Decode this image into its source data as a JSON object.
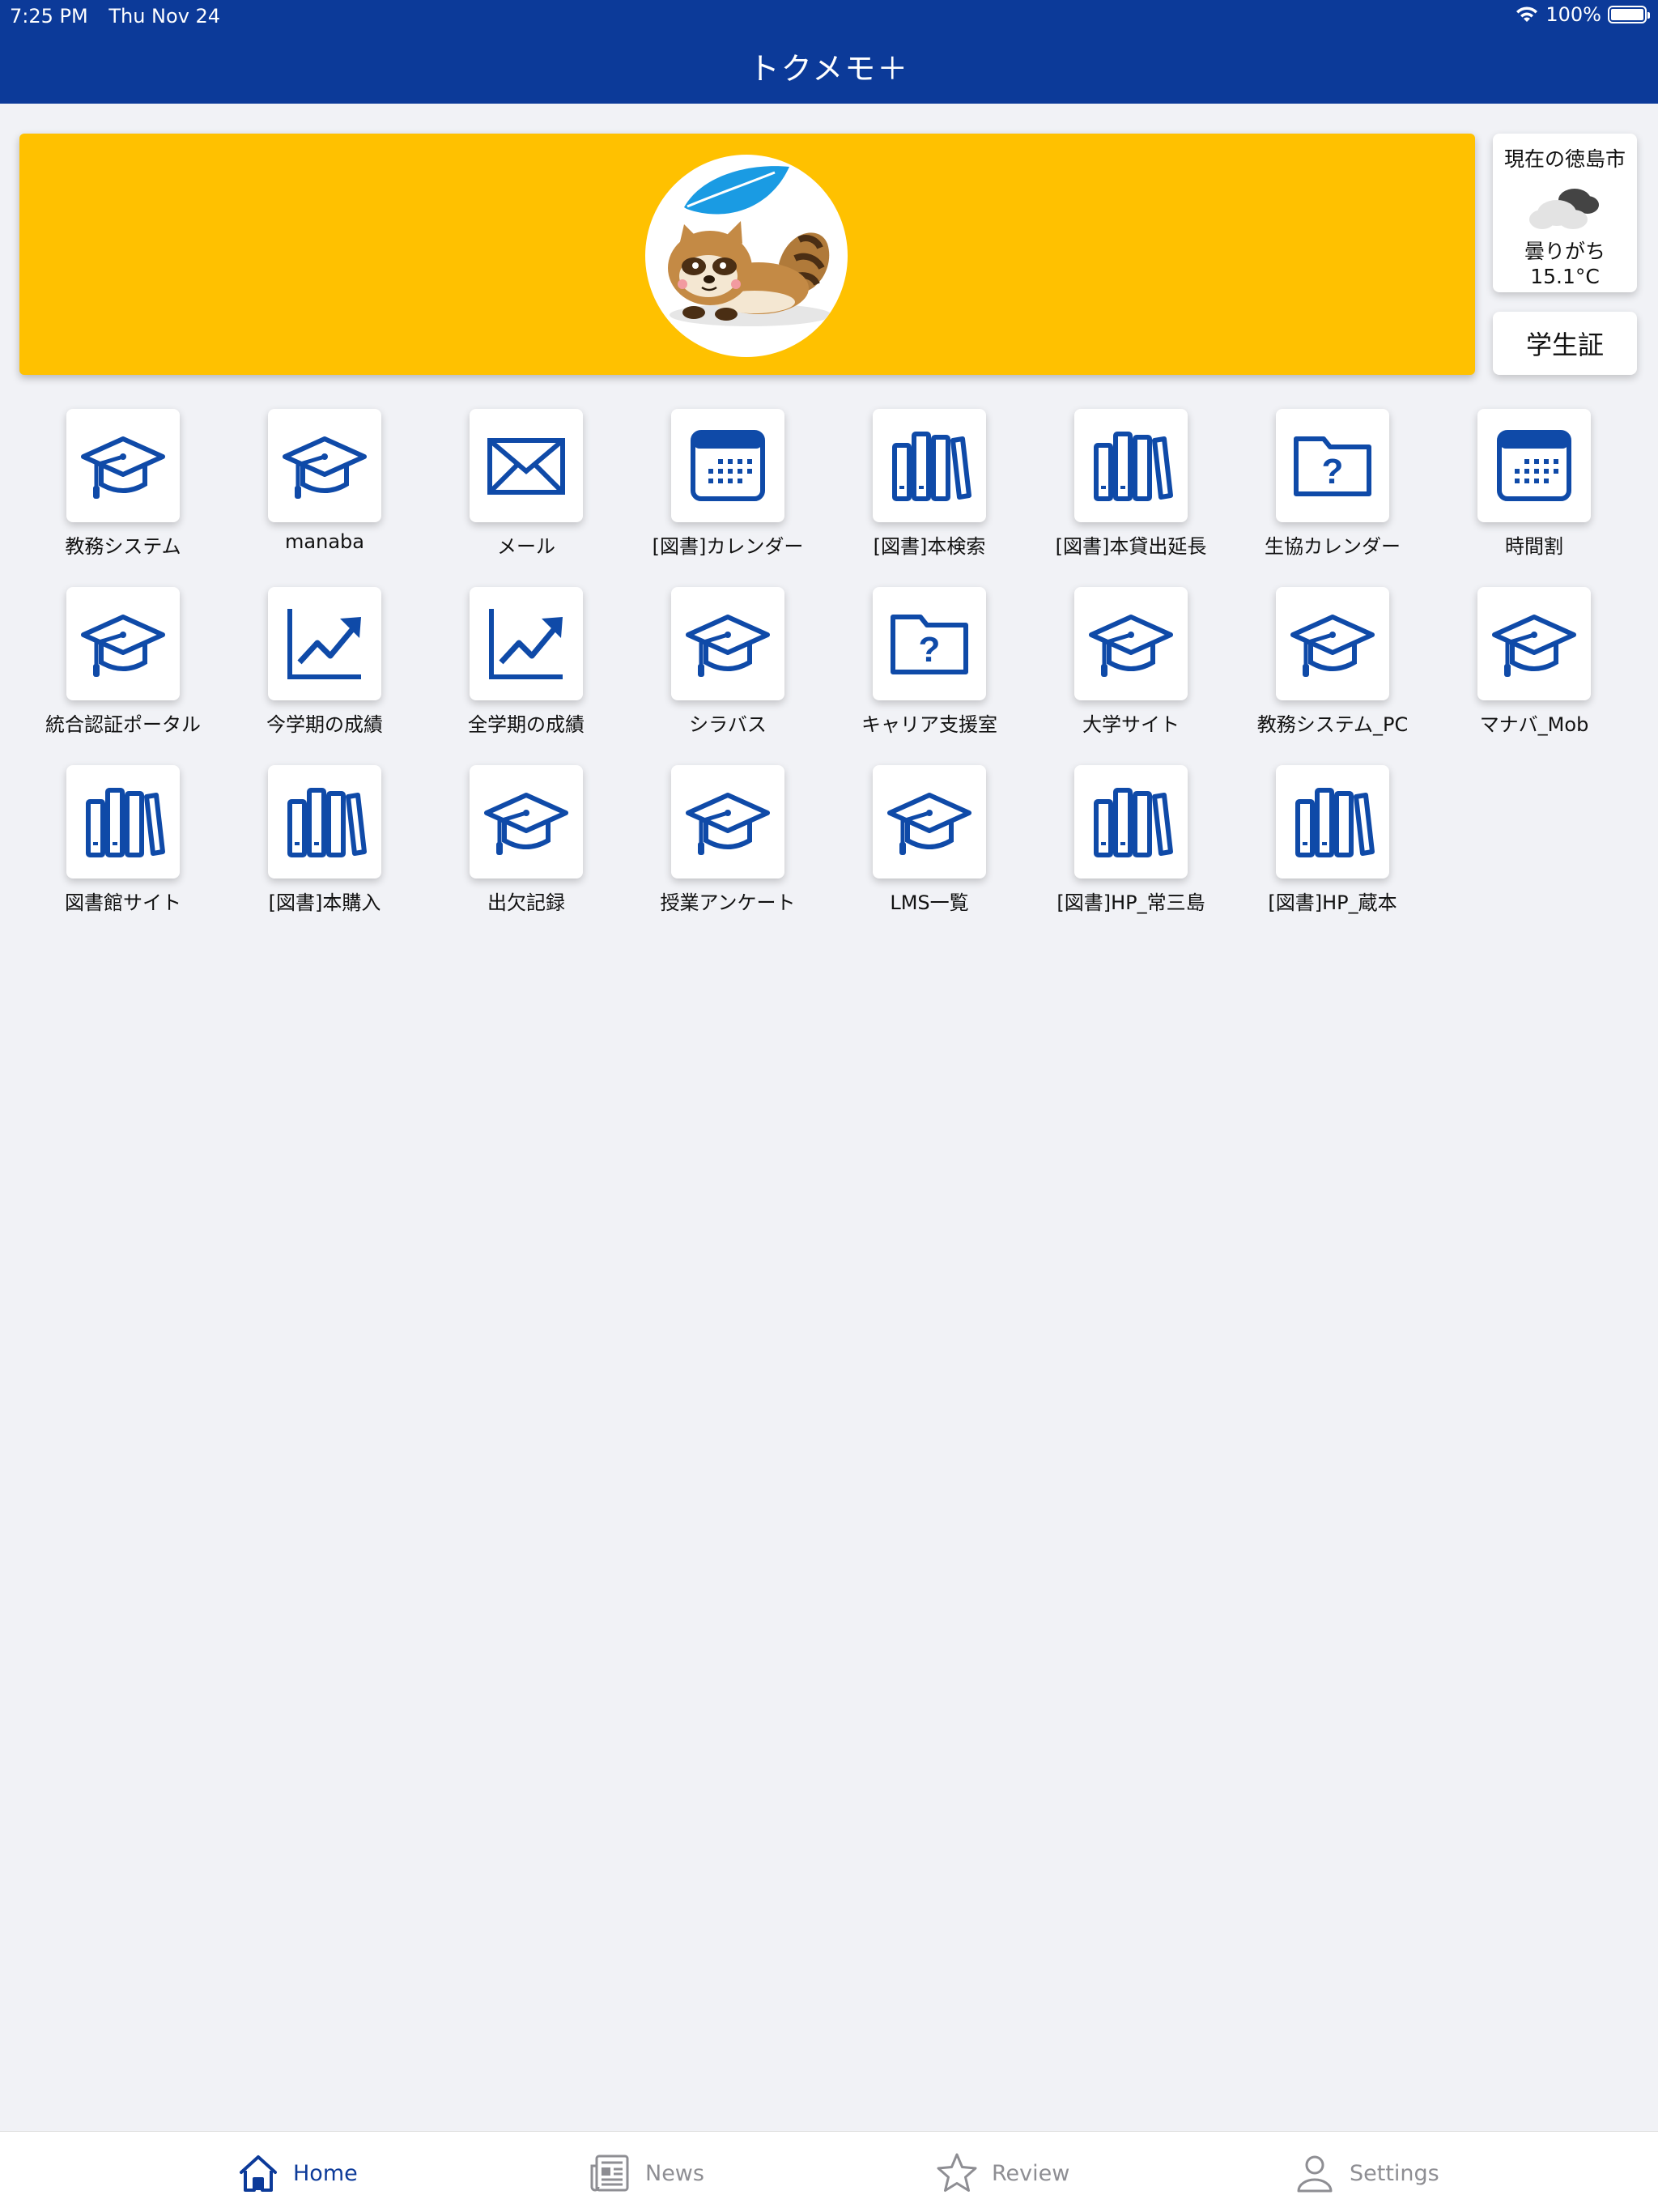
{
  "status_bar": {
    "time": "7:25 PM",
    "date": "Thu Nov 24",
    "battery": "100%"
  },
  "header": {
    "title": "トクメモ＋"
  },
  "weather": {
    "city": "現在の徳島市",
    "condition": "曇りがち",
    "temperature": "15.1°C",
    "icon": "cloudy-icon"
  },
  "student_id_button": "学生証",
  "apps": [
    {
      "label": "教務システム",
      "icon": "graduation-cap-icon"
    },
    {
      "label": "manaba",
      "icon": "graduation-cap-icon"
    },
    {
      "label": "メール",
      "icon": "envelope-icon"
    },
    {
      "label": "[図書]カレンダー",
      "icon": "calendar-icon"
    },
    {
      "label": "[図書]本検索",
      "icon": "books-icon"
    },
    {
      "label": "[図書]本貸出延長",
      "icon": "books-icon"
    },
    {
      "label": "生協カレンダー",
      "icon": "question-folder-icon"
    },
    {
      "label": "時間割",
      "icon": "calendar-icon"
    },
    {
      "label": "統合認証ポータル",
      "icon": "graduation-cap-icon"
    },
    {
      "label": "今学期の成績",
      "icon": "trend-chart-icon"
    },
    {
      "label": "全学期の成績",
      "icon": "trend-chart-icon"
    },
    {
      "label": "シラバス",
      "icon": "graduation-cap-icon"
    },
    {
      "label": "キャリア支援室",
      "icon": "question-folder-icon"
    },
    {
      "label": "大学サイト",
      "icon": "graduation-cap-icon"
    },
    {
      "label": "教務システム_PC",
      "icon": "graduation-cap-icon"
    },
    {
      "label": "マナバ_Mob",
      "icon": "graduation-cap-icon"
    },
    {
      "label": "図書館サイト",
      "icon": "books-icon"
    },
    {
      "label": "[図書]本購入",
      "icon": "books-icon"
    },
    {
      "label": "出欠記録",
      "icon": "graduation-cap-icon"
    },
    {
      "label": "授業アンケート",
      "icon": "graduation-cap-icon"
    },
    {
      "label": "LMS一覧",
      "icon": "graduation-cap-icon"
    },
    {
      "label": "[図書]HP_常三島",
      "icon": "books-icon"
    },
    {
      "label": "[図書]HP_蔵本",
      "icon": "books-icon"
    }
  ],
  "tabs": [
    {
      "label": "Home",
      "icon": "home-icon",
      "active": true
    },
    {
      "label": "News",
      "icon": "newspaper-icon",
      "active": false
    },
    {
      "label": "Review",
      "icon": "star-icon",
      "active": false
    },
    {
      "label": "Settings",
      "icon": "person-icon",
      "active": false
    }
  ],
  "colors": {
    "header": "#0c3a99",
    "banner": "#ffc100",
    "icon": "#0f4aa8",
    "background": "#f1f2f6"
  }
}
